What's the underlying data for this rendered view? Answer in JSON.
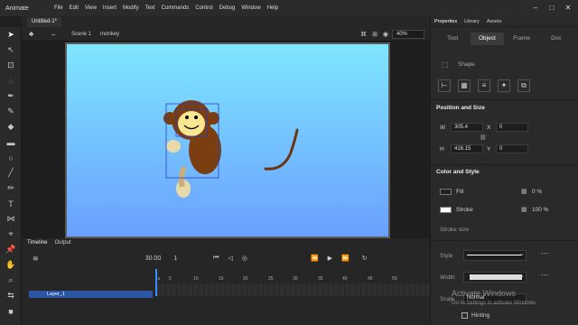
{
  "app": {
    "name": "Animate"
  },
  "menu": [
    "File",
    "Edit",
    "View",
    "Insert",
    "Modify",
    "Text",
    "Commands",
    "Control",
    "Debug",
    "Window",
    "Help"
  ],
  "tabs": {
    "document": "Untitled-1*"
  },
  "edit": {
    "scene": "Scene 1",
    "symbol": "monkey",
    "zoom": "40%"
  },
  "timeline": {
    "tabs": [
      "Timeline",
      "Output"
    ],
    "fps": "30.00",
    "frame": "1",
    "layer": "Layer_1",
    "ruler": [
      "1s",
      "5",
      "10",
      "15",
      "20",
      "25",
      "30",
      "35",
      "40",
      "45",
      "50"
    ]
  },
  "panel": {
    "tabs": [
      "Properties",
      "Library",
      "Assets"
    ],
    "subtabs": [
      "Tool",
      "Object",
      "Frame",
      "Doc"
    ],
    "shape_label": "Shape",
    "pos_section": "Position and Size",
    "w_label": "W",
    "w_value": "305.4",
    "x_label": "X",
    "x_value": "0",
    "h_label": "H",
    "h_value": "416.15",
    "y_label": "Y",
    "y_value": "0",
    "color_section": "Color and Style",
    "fill_label": "Fill",
    "fill_value": "0 %",
    "stroke_label": "Stroke",
    "stroke_value": "100 %",
    "stroke_size_label": "Stroke size",
    "style_label": "Style",
    "width_label": "Width",
    "scale_label": "Scale",
    "scale_value": "Normal",
    "hinting_label": "Hinting"
  },
  "watermark": {
    "line1": "Activate Windows",
    "line2": "Go to Settings to activate Windows."
  },
  "colors": {
    "stage_top": "#7fe6ff",
    "stage_bottom": "#6aa0ff",
    "monkey": "#7a3e10",
    "layer_highlight": "#2b56a6"
  }
}
